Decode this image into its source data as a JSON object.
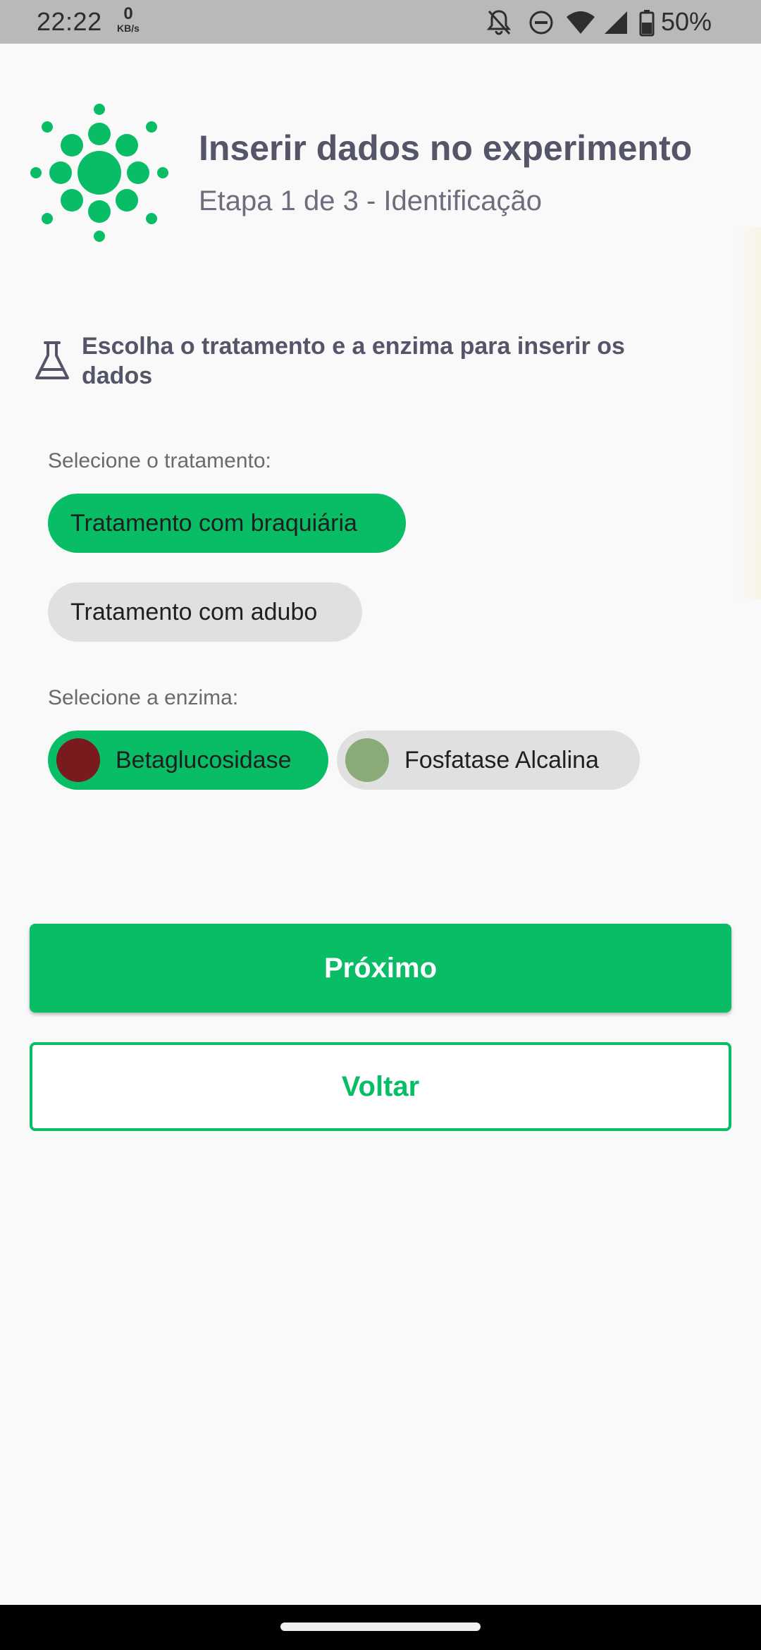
{
  "status_bar": {
    "time": "22:22",
    "net_speed_value": "0",
    "net_speed_unit": "KB/s",
    "battery_percent": "50%",
    "icons": [
      "bell-off-icon",
      "do-not-disturb-icon",
      "wifi-icon",
      "cellular-signal-icon",
      "battery-icon"
    ]
  },
  "header": {
    "logo_icon": "sun-burst-logo-icon",
    "title": "Inserir dados no experimento",
    "subtitle": "Etapa 1 de 3 - Identificação"
  },
  "section": {
    "icon": "flask-icon",
    "heading": "Escolha o tratamento e a enzima para inserir os dados"
  },
  "treatment": {
    "label": "Selecione o tratamento:",
    "options": [
      {
        "label": "Tratamento com braquiária",
        "selected": true
      },
      {
        "label": "Tratamento com adubo",
        "selected": false
      }
    ]
  },
  "enzyme": {
    "label": "Selecione a enzima:",
    "options": [
      {
        "label": "Betaglucosidase",
        "selected": true,
        "color": "#781a1e"
      },
      {
        "label": "Fosfatase Alcalina",
        "selected": false,
        "color": "#8aab78"
      }
    ]
  },
  "actions": {
    "next_label": "Próximo",
    "back_label": "Voltar"
  },
  "colors": {
    "primary": "#08bd66",
    "unselected_chip": "#e0e0e0",
    "title_text": "#55556a"
  }
}
